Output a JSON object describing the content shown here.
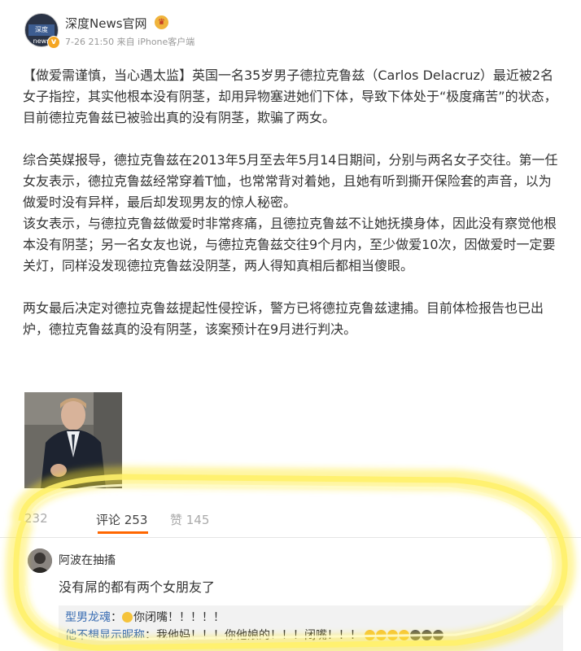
{
  "header": {
    "account_name": "深度News官网",
    "avatar_text": "深度news",
    "verified_badge": "v",
    "meta": {
      "timestamp": "7-26 21:50",
      "source": "来自 iPhone客户端"
    }
  },
  "post": {
    "paragraphs": [
      "【做爱需谨慎，当心遇太监】英国一名35岁男子德拉克鲁兹（Carlos Delacruz）最近被2名女子指控，其实他根本没有阴茎，却用异物塞进她们下体，导致下体处于“极度痛苦”的状态，目前德拉克鲁兹已被验出真的没有阴茎，欺骗了两女。",
      "",
      "综合英媒报导，德拉克鲁兹在2013年5月至去年5月14日期间，分别与两名女子交往。第一任女友表示，德拉克鲁兹经常穿着T恤，也常常背对着她，且她有听到撕开保险套的声音，以为做爱时没有异样，最后却发现男友的惊人秘密。",
      "该女表示，与德拉克鲁兹做爱时非常疼痛，且德拉克鲁兹不让她抚摸身体，因此没有察觉他根本没有阴茎；另一名女友也说，与德拉克鲁兹交往9个月内，至少做爱10次，因做爱时一定要关灯，同样没发现德拉克鲁兹没阴茎，两人得知真相后都相当傻眼。",
      "",
      "两女最后决定对德拉克鲁兹提起性侵控诉，警方已将德拉克鲁兹逮捕。目前体检报告也已出炉，德拉克鲁兹真的没有阴茎，该案预计在9月进行判决。"
    ]
  },
  "actions": {
    "forward": "232",
    "comment": "评论 253",
    "like": "赞 145"
  },
  "comment": {
    "author": "阿波在抽搐",
    "text": "没有屌的都有两个女朋友了",
    "replies": [
      {
        "name": "型男龙魂",
        "text": "你闭嘴！！！！！"
      },
      {
        "name": "他不想显示昵称",
        "text": "我他妈！！！你他娘的！！！闭嘴！！！"
      }
    ]
  },
  "colors": {
    "accent": "#ff6600",
    "link": "#3a6db3",
    "highlight": "#ffe92e"
  }
}
